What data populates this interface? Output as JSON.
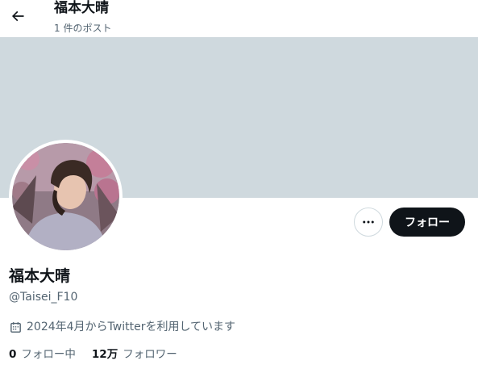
{
  "header": {
    "name": "福本大晴",
    "post_count": "1 件のポスト"
  },
  "profile": {
    "display_name": "福本大晴",
    "handle": "@Taisei_F10",
    "joined": "2024年4月からTwitterを利用しています",
    "follow_label": "フォロー",
    "following_count": "0",
    "following_label": "フォロー中",
    "followers_count": "12万",
    "followers_label": "フォロワー"
  },
  "colors": {
    "banner": "#cfd9de",
    "button_dark": "#0f1419",
    "secondary_text": "#536471"
  },
  "icons": {
    "back": "back-arrow-icon",
    "more": "more-dots-icon",
    "calendar": "calendar-icon"
  }
}
